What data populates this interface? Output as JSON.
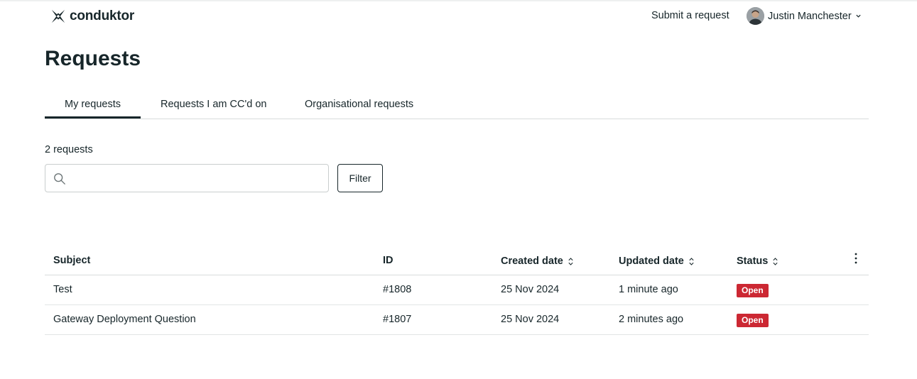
{
  "header": {
    "brand": "conduktor",
    "submit_label": "Submit a request",
    "user_name": "Justin Manchester"
  },
  "page": {
    "title": "Requests"
  },
  "tabs": [
    {
      "label": "My requests",
      "active": true
    },
    {
      "label": "Requests I am CC'd on",
      "active": false
    },
    {
      "label": "Organisational requests",
      "active": false
    }
  ],
  "list": {
    "count_label": "2 requests",
    "search_placeholder": "",
    "filter_label": "Filter"
  },
  "table": {
    "columns": [
      "Subject",
      "ID",
      "Created date",
      "Updated date",
      "Status"
    ],
    "rows": [
      {
        "subject": "Test",
        "id": "#1808",
        "created": "25 Nov 2024",
        "updated": "1 minute ago",
        "status": "Open"
      },
      {
        "subject": "Gateway Deployment Question",
        "id": "#1807",
        "created": "25 Nov 2024",
        "updated": "2 minutes ago",
        "status": "Open"
      }
    ]
  },
  "colors": {
    "text": "#17262a",
    "status_open": "#cc2833",
    "divider": "#d8dcdc"
  }
}
